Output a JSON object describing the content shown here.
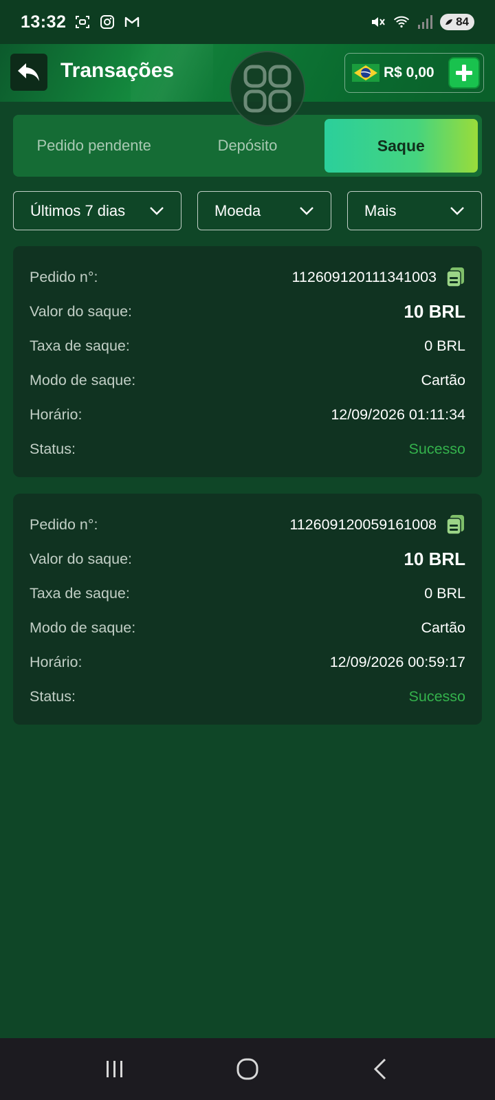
{
  "status_bar": {
    "time": "13:32",
    "battery": "84",
    "icons": [
      "screenshot-icon",
      "instagram-icon",
      "gmail-icon",
      "mute-icon",
      "wifi-icon",
      "signal-icon",
      "battery-icon"
    ]
  },
  "header": {
    "title": "Transações",
    "balance": "R$ 0,00",
    "currency_flag": "brazil-flag-icon"
  },
  "tabs": [
    {
      "label": "Pedido pendente",
      "active": false
    },
    {
      "label": "Depósito",
      "active": false
    },
    {
      "label": "Saque",
      "active": true
    }
  ],
  "filters": {
    "period": "Últimos 7 dias",
    "currency": "Moeda",
    "more": "Mais"
  },
  "labels": {
    "order": "Pedido n°:",
    "amount": "Valor do saque:",
    "fee": "Taxa de saque:",
    "mode": "Modo de saque:",
    "time": "Horário:",
    "status": "Status:"
  },
  "transactions": [
    {
      "order_no": "112609120111341003",
      "amount": "10 BRL",
      "fee": "0 BRL",
      "mode": "Cartão",
      "time": "12/09/2026 01:11:34",
      "status": "Sucesso"
    },
    {
      "order_no": "112609120059161008",
      "amount": "10 BRL",
      "fee": "0 BRL",
      "mode": "Cartão",
      "time": "12/09/2026 00:59:17",
      "status": "Sucesso"
    }
  ],
  "colors": {
    "background": "#0f4627",
    "accent": "#19c24e",
    "success": "#34b24c",
    "card": "#103321"
  }
}
